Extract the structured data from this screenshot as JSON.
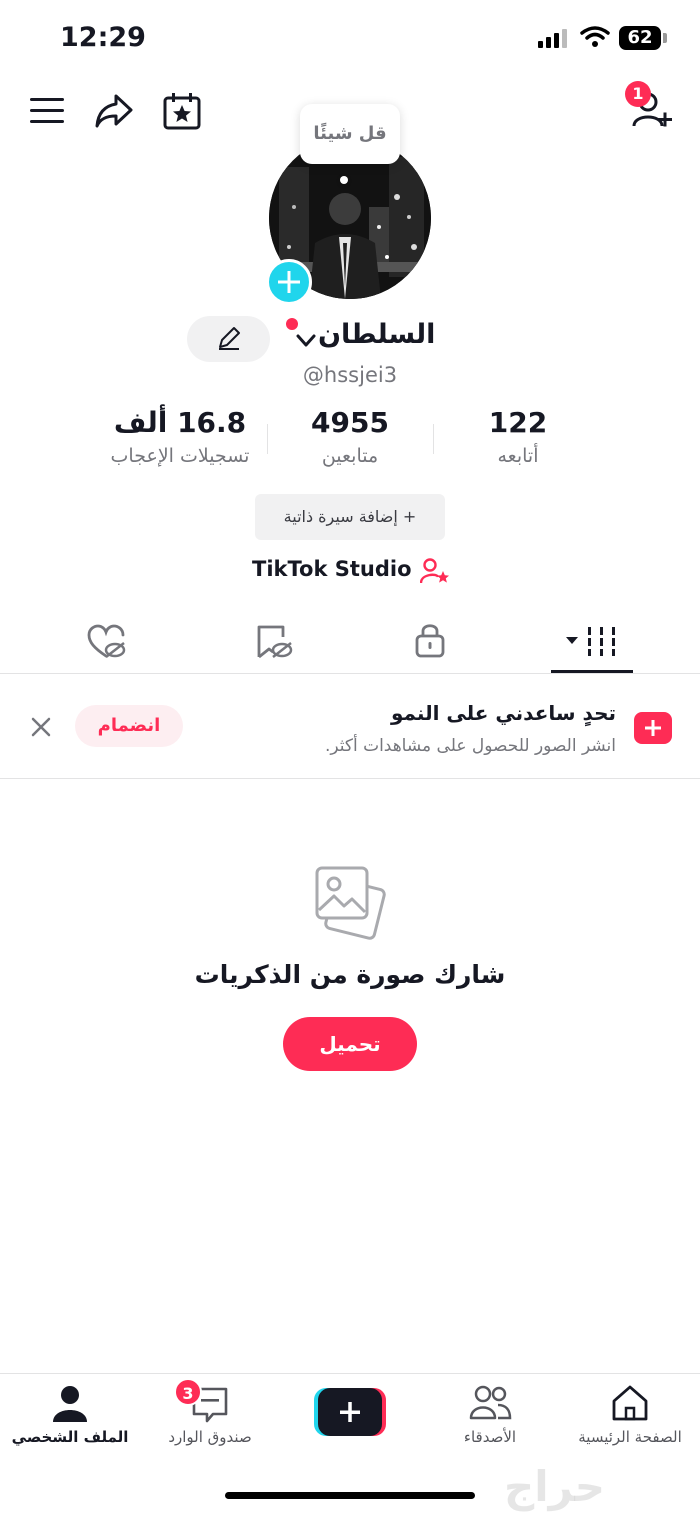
{
  "status_bar": {
    "time": "12:29",
    "battery": "62"
  },
  "header": {
    "notification_badge": "1"
  },
  "profile": {
    "speech_bubble": "قل شيئًا",
    "display_name": "السلطان",
    "username": "@hssjei3",
    "stats": [
      {
        "value": "122",
        "label": "أتابعه"
      },
      {
        "value": "4955",
        "label": "متابعين"
      },
      {
        "value": "16.8 ألف",
        "label": "تسجيلات الإعجاب"
      }
    ],
    "add_bio": "+ إضافة سيرة ذاتية",
    "studio": "TikTok Studio"
  },
  "challenge": {
    "title": "تحدٍ ساعدني على النمو",
    "subtitle": "انشر الصور للحصول على مشاهدات أكثر.",
    "join": "انضمام"
  },
  "empty_state": {
    "title": "شارك صورة من الذكريات",
    "upload": "تحميل"
  },
  "bottom_nav": {
    "home": "الصفحة الرئيسية",
    "friends": "الأصدقاء",
    "inbox": "صندوق الوارد",
    "inbox_badge": "3",
    "profile": "الملف الشخصي"
  },
  "watermark": "حراج",
  "colors": {
    "accent": "#fe2c55",
    "cyan": "#20d5ec",
    "text": "#161823",
    "muted": "#75767c"
  }
}
